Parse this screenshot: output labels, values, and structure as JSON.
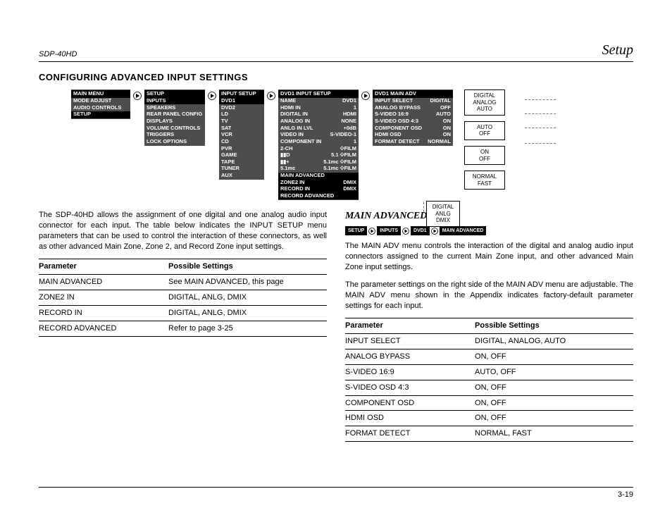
{
  "header": {
    "product": "SDP-40HD",
    "section": "Setup"
  },
  "title": "CONFIGURING ADVANCED INPUT SETTINGS",
  "menus": {
    "main": {
      "title": "MAIN MENU",
      "items": [
        "MODE ADJUST",
        "AUDIO CONTROLS",
        "SETUP"
      ],
      "active_index": 2
    },
    "setup": {
      "title": "SETUP",
      "items": [
        "INPUTS",
        "SPEAKERS",
        "REAR PANEL CONFIG",
        "DISPLAYS",
        "VOLUME CONTROLS",
        "TRIGGERS",
        "LOCK OPTIONS"
      ],
      "active_index": 0
    },
    "input_setup": {
      "title": "INPUT SETUP",
      "items": [
        "DVD1",
        "DVD2",
        "LD",
        "TV",
        "SAT",
        "VCR",
        "CD",
        "PVR",
        "GAME",
        "TAPE",
        "TUNER",
        "AUX"
      ],
      "active_index": 0
    },
    "dvd1_input": {
      "title": "DVD1 INPUT SETUP",
      "rows": [
        {
          "l": "NAME",
          "r": "DVD1"
        },
        {
          "l": "HDMI IN",
          "r": "1"
        },
        {
          "l": "DIGITAL IN",
          "r": "HDMI"
        },
        {
          "l": "ANALOG IN",
          "r": "NONE"
        },
        {
          "l": "ANLG IN LVL",
          "r": "+0dB"
        },
        {
          "l": "VIDEO IN",
          "r": "S-VIDEO-1"
        },
        {
          "l": "COMPONENT IN",
          "r": "1"
        },
        {
          "l": "2-CH",
          "r": "⟐FILM"
        },
        {
          "l": "▮▮D",
          "r": "5.1 ⟐FILM"
        },
        {
          "l": "▮▮+",
          "r": "5.1mc ⟐FILM"
        },
        {
          "l": "5.1mc",
          "r": "5.1mc ⟐FILM"
        }
      ],
      "active_row": {
        "l": "MAIN ADVANCED",
        "r": ""
      },
      "sub_rows": [
        {
          "l": "ZONE2 IN",
          "r": "DMIX"
        },
        {
          "l": "RECORD IN",
          "r": "DMIX"
        },
        {
          "l": "RECORD ADVANCED",
          "r": ""
        }
      ]
    },
    "dvd1_main_adv": {
      "title": "DVD1 MAIN ADV",
      "rows": [
        {
          "l": "INPUT SELECT",
          "r": "DIGITAL"
        },
        {
          "l": "ANALOG BYPASS",
          "r": "OFF"
        },
        {
          "l": "S-VIDEO 16:9",
          "r": "AUTO"
        },
        {
          "l": "S-VIDEO OSD 4:3",
          "r": "ON"
        },
        {
          "l": "COMPONENT OSD",
          "r": "ON"
        },
        {
          "l": "HDMI OSD",
          "r": "ON"
        },
        {
          "l": "FORMAT DETECT",
          "r": "NORMAL"
        }
      ]
    }
  },
  "side_options": [
    [
      "DIGITAL",
      "ANALOG",
      "AUTO"
    ],
    [
      "AUTO",
      "OFF"
    ],
    [
      "ON",
      "OFF"
    ],
    [
      "NORMAL",
      "FAST"
    ]
  ],
  "record_options": [
    "DIGITAL",
    "ANLG",
    "DMIX"
  ],
  "left_col": {
    "para1": "The SDP-40HD allows the assignment of one digital and one analog audio input connector for each input. The table below indicates the INPUT SETUP menu parameters that can be used to control the interaction of these connectors, as well as other advanced Main Zone, Zone 2, and Record Zone input settings.",
    "table": {
      "head": [
        "Parameter",
        "Possible Settings"
      ],
      "rows": [
        [
          "MAIN ADVANCED",
          "See MAIN ADVANCED, this page"
        ],
        [
          "ZONE2 IN",
          "DIGITAL, ANLG, DMIX"
        ],
        [
          "RECORD IN",
          "DIGITAL, ANLG, DMIX"
        ],
        [
          "RECORD ADVANCED",
          "Refer to page 3-25"
        ]
      ]
    }
  },
  "right_col": {
    "heading": "MAIN ADVANCED",
    "crumbs": [
      "SETUP",
      "INPUTS",
      "DVD1",
      "MAIN ADVANCED"
    ],
    "para1": "The MAIN ADV menu controls the interaction of the digital and analog audio input connectors assigned to the current Main Zone input, and other advanced Main Zone input settings.",
    "para2": "The parameter settings on the right side of the MAIN ADV menu are adjustable. The MAIN ADV menu shown in the Appendix indicates factory-default parameter settings for each input.",
    "table": {
      "head": [
        "Parameter",
        "Possible Settings"
      ],
      "rows": [
        [
          "INPUT SELECT",
          "DIGITAL, ANALOG, AUTO"
        ],
        [
          "ANALOG BYPASS",
          "ON, OFF"
        ],
        [
          "S-VIDEO 16:9",
          "AUTO, OFF"
        ],
        [
          "S-VIDEO OSD 4:3",
          "ON, OFF"
        ],
        [
          "COMPONENT OSD",
          "ON, OFF"
        ],
        [
          "HDMI OSD",
          "ON, OFF"
        ],
        [
          "FORMAT DETECT",
          "NORMAL, FAST"
        ]
      ]
    }
  },
  "footer": {
    "page_no": "3-19"
  }
}
